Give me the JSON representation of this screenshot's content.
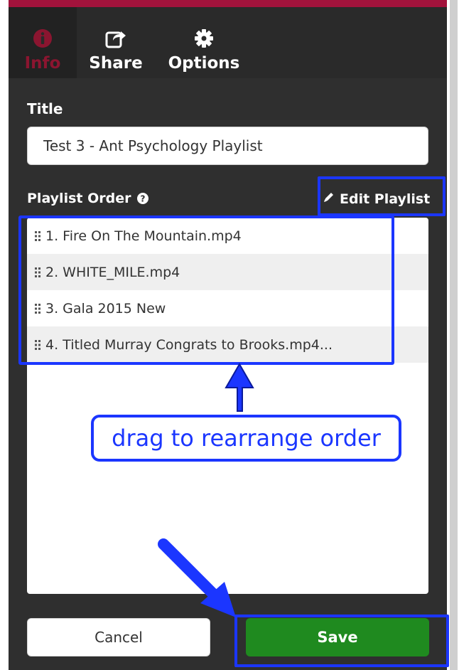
{
  "tabs": [
    {
      "label": "Info",
      "icon": "info-icon",
      "active": true
    },
    {
      "label": "Share",
      "icon": "share-icon",
      "active": false
    },
    {
      "label": "Options",
      "icon": "gear-icon",
      "active": false
    }
  ],
  "form": {
    "title_label": "Title",
    "title_value": "Test 3 - Ant Psychology Playlist",
    "playlist_label": "Playlist Order",
    "edit_playlist_label": "Edit Playlist"
  },
  "playlist": {
    "items": [
      "1. Fire On The Mountain.mp4",
      "2. WHITE_MILE.mp4",
      "3. Gala 2015 New",
      "4. Titled Murray Congrats to Brooks.mp4..."
    ]
  },
  "annotation": {
    "callout_text": "drag to rearrange order"
  },
  "buttons": {
    "cancel_label": "Cancel",
    "save_label": "Save"
  },
  "colors": {
    "accent_stripe": "#a2133c",
    "active_tab_text": "#8b1530",
    "panel_bg": "#2f2f2f",
    "save_green": "#1f8a1f",
    "annotation_blue": "#1b36ff"
  }
}
